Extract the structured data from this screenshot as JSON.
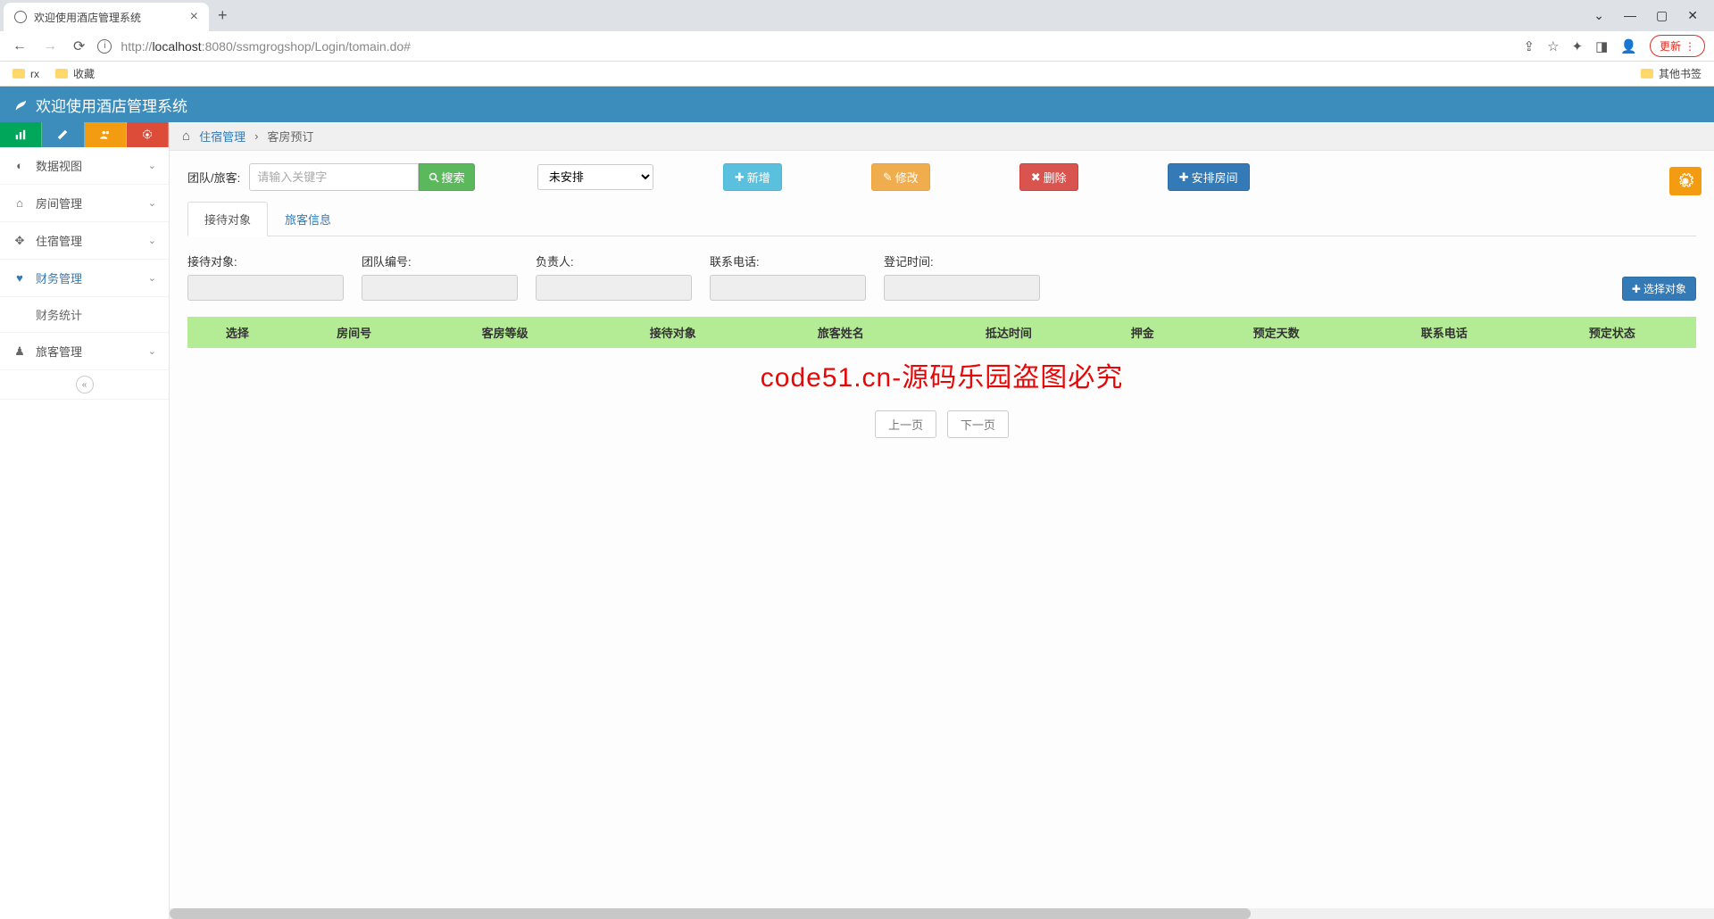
{
  "browser": {
    "tab_title": "欢迎使用酒店管理系统",
    "url_prefix": "http://",
    "url_host": "localhost",
    "url_port_path": ":8080/ssmgrogshop/Login/tomain.do#",
    "update_label": "更新",
    "bookmark_rx": "rx",
    "bookmark_fav": "收藏",
    "other_bookmarks": "其他书签"
  },
  "app_header": {
    "title": "欢迎使用酒店管理系统"
  },
  "sidebar": {
    "items": [
      {
        "icon": "dashboard",
        "label": "数据视图"
      },
      {
        "icon": "home",
        "label": "房间管理"
      },
      {
        "icon": "move",
        "label": "住宿管理"
      },
      {
        "icon": "heart",
        "label": "财务管理"
      },
      {
        "icon": "user",
        "label": "旅客管理"
      }
    ],
    "submenu_finance": "财务统计"
  },
  "breadcrumb": {
    "level1": "住宿管理",
    "level2": "客房预订"
  },
  "filter": {
    "label": "团队/旅客:",
    "placeholder": "请输入关键字",
    "search_btn": "搜索",
    "select_value": "未安排",
    "add_btn": "新增",
    "edit_btn": "修改",
    "delete_btn": "删除",
    "arrange_btn": "安排房间"
  },
  "tabs": {
    "tab1": "接待对象",
    "tab2": "旅客信息"
  },
  "form": {
    "f1": "接待对象:",
    "f2": "团队编号:",
    "f3": "负责人:",
    "f4": "联系电话:",
    "f5": "登记时间:",
    "select_obj": "选择对象"
  },
  "table": {
    "headers": [
      "选择",
      "房间号",
      "客房等级",
      "接待对象",
      "旅客姓名",
      "抵达时间",
      "押金",
      "预定天数",
      "联系电话",
      "预定状态"
    ]
  },
  "watermark": "code51.cn-源码乐园盗图必究",
  "pager": {
    "prev": "上一页",
    "next": "下一页"
  }
}
